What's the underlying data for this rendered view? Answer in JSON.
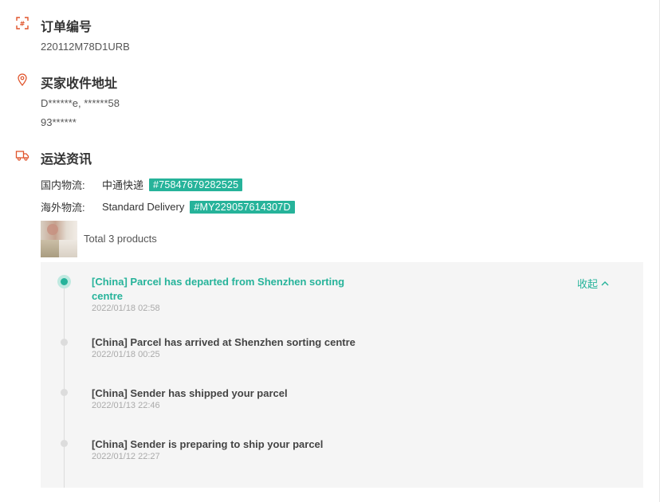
{
  "order": {
    "title": "订单编号",
    "number": "220112M78D1URB",
    "icon": "order-number-icon"
  },
  "address": {
    "title": "买家收件地址",
    "line1": "D******e, ******58",
    "line2": "93******",
    "icon": "location-pin-icon"
  },
  "shipping": {
    "title": "运送资讯",
    "icon": "truck-icon",
    "domestic_label": "国内物流:",
    "domestic_carrier": "中通快递",
    "domestic_tracking": "#75847679282525",
    "overseas_label": "海外物流:",
    "overseas_carrier": "Standard Delivery",
    "overseas_tracking": "#MY229057614307D",
    "total_products": "Total 3 products",
    "accent_color": "#26b39a"
  },
  "timeline": {
    "collapse_label": "收起",
    "events": [
      {
        "title": "[China] Parcel has departed from Shenzhen sorting centre",
        "time": "2022/01/18 02:58",
        "active": true
      },
      {
        "title": "[China] Parcel has arrived at Shenzhen sorting centre",
        "time": "2022/01/18 00:25",
        "active": false
      },
      {
        "title": "[China] Sender has shipped your parcel",
        "time": "2022/01/13 22:46",
        "active": false
      },
      {
        "title": "[China] Sender is preparing to ship your parcel",
        "time": "2022/01/12 22:27",
        "active": false
      }
    ]
  }
}
